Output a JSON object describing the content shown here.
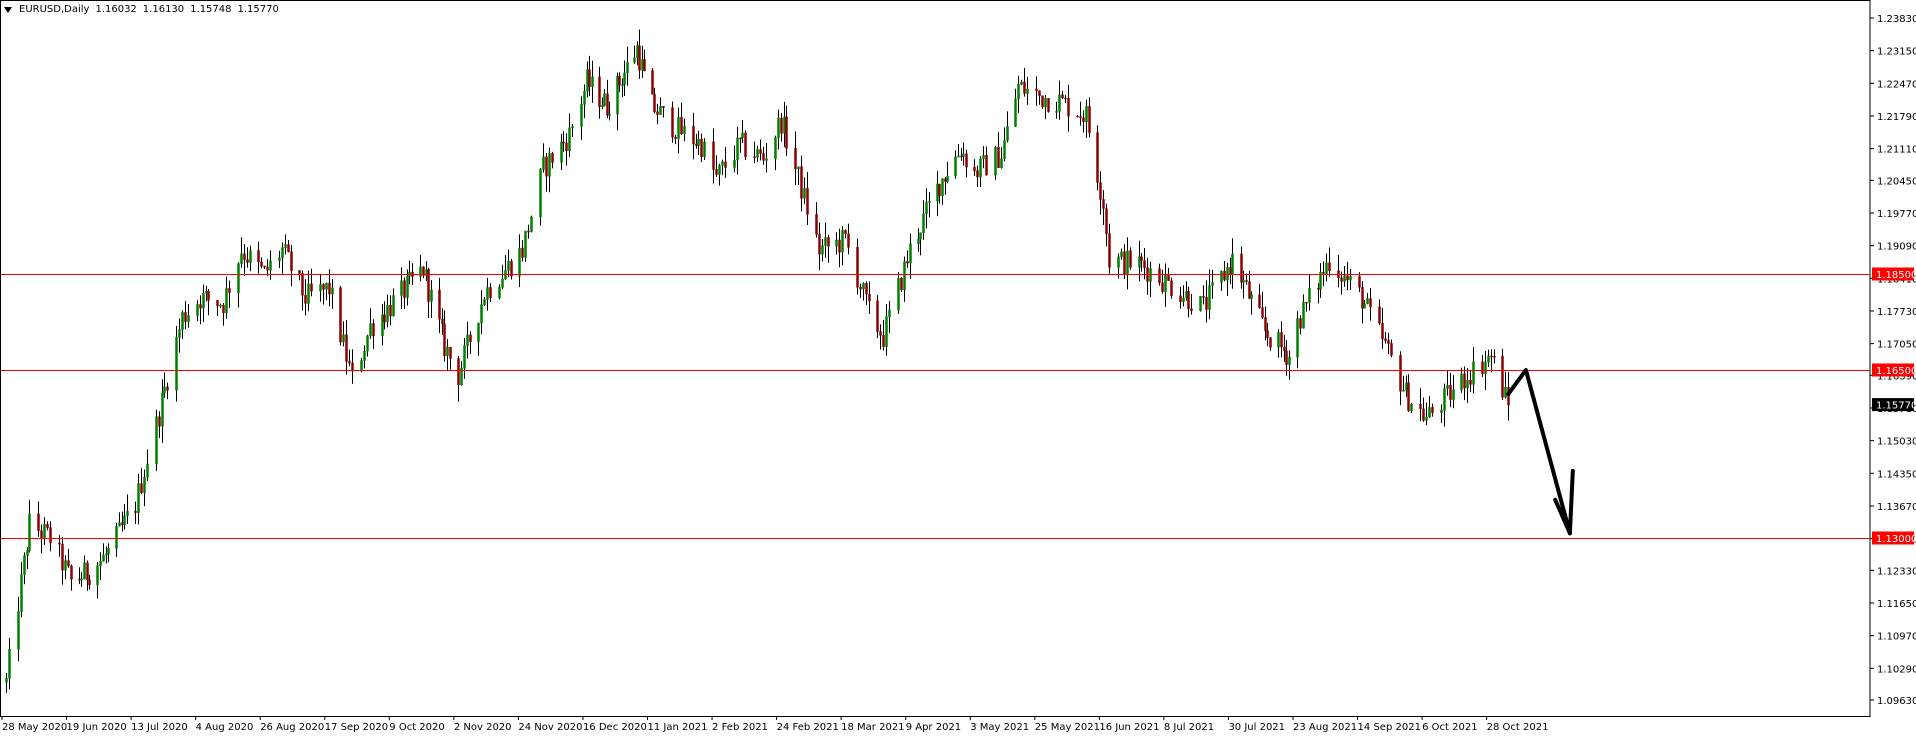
{
  "header": {
    "symbol": "EURUSD,Daily",
    "open": "1.16032",
    "high": "1.16130",
    "low": "1.15748",
    "close": "1.15770"
  },
  "chart_data": {
    "type": "candlestick",
    "title": "EURUSD,Daily",
    "timeframe": "Daily",
    "ylim": [
      1.0963,
      1.2383
    ],
    "y_ticks": [
      "1.23830",
      "1.23150",
      "1.22470",
      "1.21790",
      "1.21110",
      "1.20450",
      "1.19770",
      "1.19090",
      "1.18410",
      "1.17730",
      "1.17050",
      "1.16390",
      "1.15710",
      "1.15030",
      "1.14350",
      "1.13670",
      "1.12990",
      "1.12330",
      "1.11650",
      "1.10970",
      "1.10290",
      "1.09630"
    ],
    "x_ticks": [
      "28 May 2020",
      "19 Jun 2020",
      "13 Jul 2020",
      "4 Aug 2020",
      "26 Aug 2020",
      "17 Sep 2020",
      "9 Oct 2020",
      "2 Nov 2020",
      "24 Nov 2020",
      "16 Dec 2020",
      "11 Jan 2021",
      "2 Feb 2021",
      "24 Feb 2021",
      "18 Mar 2021",
      "9 Apr 2021",
      "3 May 2021",
      "25 May 2021",
      "16 Jun 2021",
      "8 Jul 2021",
      "30 Jul 2021",
      "23 Aug 2021",
      "14 Sep 2021",
      "6 Oct 2021",
      "28 Oct 2021"
    ],
    "bull_color": "#008000",
    "bear_color": "#8b0000",
    "price_path": [
      [
        "28 May 2020",
        1.1
      ],
      [
        "5 Jun 2020",
        1.133
      ],
      [
        "12 Jun 2020",
        1.13
      ],
      [
        "19 Jun 2020",
        1.121
      ],
      [
        "26 Jun 2020",
        1.123
      ],
      [
        "3 Jul 2020",
        1.127
      ],
      [
        "13 Jul 2020",
        1.137
      ],
      [
        "21 Jul 2020",
        1.156
      ],
      [
        "29 Jul 2020",
        1.176
      ],
      [
        "4 Aug 2020",
        1.18
      ],
      [
        "12 Aug 2020",
        1.179
      ],
      [
        "18 Aug 2020",
        1.19
      ],
      [
        "26 Aug 2020",
        1.185
      ],
      [
        "1 Sep 2020",
        1.19
      ],
      [
        "9 Sep 2020",
        1.18
      ],
      [
        "17 Sep 2020",
        1.182
      ],
      [
        "25 Sep 2020",
        1.163
      ],
      [
        "1 Oct 2020",
        1.174
      ],
      [
        "9 Oct 2020",
        1.179
      ],
      [
        "20 Oct 2020",
        1.186
      ],
      [
        "28 Oct 2020",
        1.17
      ],
      [
        "2 Nov 2020",
        1.164
      ],
      [
        "11 Nov 2020",
        1.181
      ],
      [
        "24 Nov 2020",
        1.19
      ],
      [
        "1 Dec 2020",
        1.207
      ],
      [
        "10 Dec 2020",
        1.214
      ],
      [
        "16 Dec 2020",
        1.225
      ],
      [
        "24 Dec 2020",
        1.22
      ],
      [
        "5 Jan 2021",
        1.232
      ],
      [
        "11 Jan 2021",
        1.22
      ],
      [
        "20 Jan 2021",
        1.215
      ],
      [
        "28 Jan 2021",
        1.212
      ],
      [
        "2 Feb 2021",
        1.205
      ],
      [
        "10 Feb 2021",
        1.212
      ],
      [
        "18 Feb 2021",
        1.209
      ],
      [
        "24 Feb 2021",
        1.217
      ],
      [
        "2 Mar 2021",
        1.205
      ],
      [
        "9 Mar 2021",
        1.19
      ],
      [
        "18 Mar 2021",
        1.192
      ],
      [
        "26 Mar 2021",
        1.177
      ],
      [
        "31 Mar 2021",
        1.172
      ],
      [
        "9 Apr 2021",
        1.19
      ],
      [
        "20 Apr 2021",
        1.204
      ],
      [
        "28 Apr 2021",
        1.211
      ],
      [
        "3 May 2021",
        1.206
      ],
      [
        "12 May 2021",
        1.21
      ],
      [
        "18 May 2021",
        1.224
      ],
      [
        "25 May 2021",
        1.222
      ],
      [
        "1 Jun 2021",
        1.221
      ],
      [
        "10 Jun 2021",
        1.218
      ],
      [
        "16 Jun 2021",
        1.2
      ],
      [
        "18 Jun 2021",
        1.188
      ],
      [
        "29 Jun 2021",
        1.187
      ],
      [
        "8 Jul 2021",
        1.183
      ],
      [
        "20 Jul 2021",
        1.178
      ],
      [
        "30 Jul 2021",
        1.188
      ],
      [
        "11 Aug 2021",
        1.173
      ],
      [
        "20 Aug 2021",
        1.168
      ],
      [
        "23 Aug 2021",
        1.175
      ],
      [
        "3 Sep 2021",
        1.188
      ],
      [
        "14 Sep 2021",
        1.18
      ],
      [
        "22 Sep 2021",
        1.17
      ],
      [
        "29 Sep 2021",
        1.16
      ],
      [
        "6 Oct 2021",
        1.155
      ],
      [
        "14 Oct 2021",
        1.16
      ],
      [
        "20 Oct 2021",
        1.164
      ],
      [
        "28 Oct 2021",
        1.168
      ],
      [
        "3 Nov 2021",
        1.1577
      ]
    ],
    "horizontal_lines": [
      {
        "label": "1.18500",
        "value": 1.185,
        "color": "#ff0000"
      },
      {
        "label": "1.16500",
        "value": 1.165,
        "color": "#ff0000"
      },
      {
        "label": "1.13000",
        "value": 1.13,
        "color": "#ff0000"
      }
    ],
    "current_price": {
      "label": "1.15770",
      "value": 1.1577,
      "color": "#000000"
    },
    "annotation": {
      "type": "arrow",
      "color": "#000000",
      "path": [
        [
          "3 Nov 2021",
          1.16
        ],
        [
          "9 Nov 2021",
          1.165
        ],
        [
          "24 Nov 2021",
          1.131
        ]
      ],
      "head": [
        [
          "19 Nov 2021",
          1.138
        ],
        [
          "24 Nov 2021",
          1.131
        ],
        [
          "25 Nov 2021",
          1.144
        ]
      ]
    }
  }
}
